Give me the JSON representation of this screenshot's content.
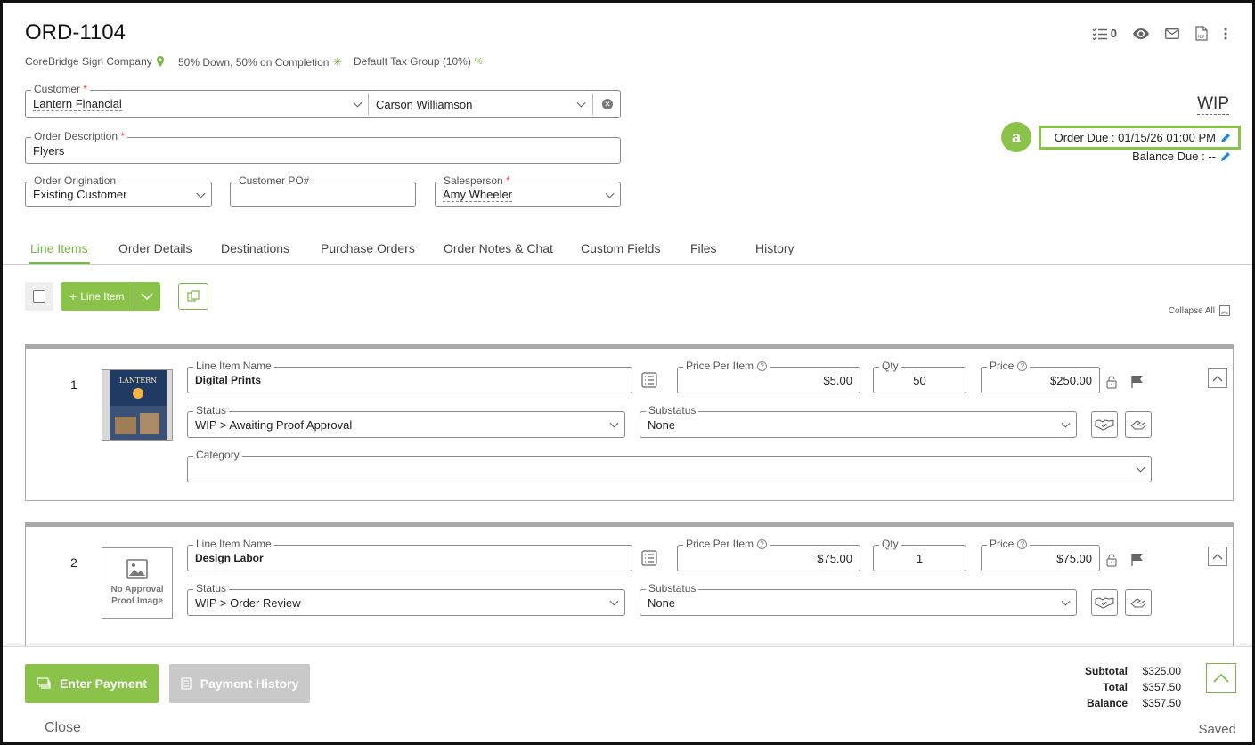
{
  "order": {
    "id": "ORD-1104",
    "company": "CoreBridge Sign Company",
    "payment_terms": "50% Down, 50% on Completion",
    "tax_group": "Default Tax Group (10%)",
    "status": "WIP",
    "due": "Order Due : 01/15/26 01:00 PM",
    "balance_due": "Balance Due : --",
    "annotation_badge": "a"
  },
  "header_icons": {
    "tasks_count": "0"
  },
  "form": {
    "customer_label": "Customer",
    "customer_value": "Lantern Financial",
    "contact_value": "Carson Williamson",
    "description_label": "Order Description",
    "description_value": "Flyers",
    "origination_label": "Order Origination",
    "origination_value": "Existing Customer",
    "po_label": "Customer PO#",
    "po_value": "",
    "salesperson_label": "Salesperson",
    "salesperson_value": "Amy Wheeler",
    "required_marker": "*"
  },
  "tabs": [
    {
      "label": "Line Items",
      "active": true
    },
    {
      "label": "Order Details"
    },
    {
      "label": "Destinations"
    },
    {
      "label": "Purchase Orders"
    },
    {
      "label": "Order Notes & Chat"
    },
    {
      "label": "Custom Fields"
    },
    {
      "label": "Files"
    },
    {
      "label": "History"
    }
  ],
  "toolbar": {
    "add_line_item": "Line Item",
    "collapse_all": "Collapse All"
  },
  "line_items": [
    {
      "number": "1",
      "name_label": "Line Item Name",
      "name": "Digital Prints",
      "price_per_item_label": "Price Per Item",
      "price_per_item": "$5.00",
      "qty_label": "Qty",
      "qty": "50",
      "price_label": "Price",
      "price": "$250.00",
      "status_label": "Status",
      "status": "WIP > Awaiting Proof Approval",
      "substatus_label": "Substatus",
      "substatus": "None",
      "category_label": "Category",
      "category": "",
      "thumbnail_text": "LANTERN"
    },
    {
      "number": "2",
      "name_label": "Line Item Name",
      "name": "Design Labor",
      "price_per_item_label": "Price Per Item",
      "price_per_item": "$75.00",
      "qty_label": "Qty",
      "qty": "1",
      "price_label": "Price",
      "price": "$75.00",
      "status_label": "Status",
      "status": "WIP > Order Review",
      "substatus_label": "Substatus",
      "substatus": "None",
      "no_image_text": "No Approval Proof Image"
    }
  ],
  "footer": {
    "enter_payment": "Enter Payment",
    "payment_history": "Payment History",
    "close": "Close",
    "saved": "Saved",
    "subtotal_label": "Subtotal",
    "subtotal": "$325.00",
    "total_label": "Total",
    "total": "$357.50",
    "balance_label": "Balance",
    "balance": "$357.50"
  },
  "colors": {
    "accent": "#8bc34a",
    "required": "#e53935",
    "link": "#1e88e5"
  }
}
